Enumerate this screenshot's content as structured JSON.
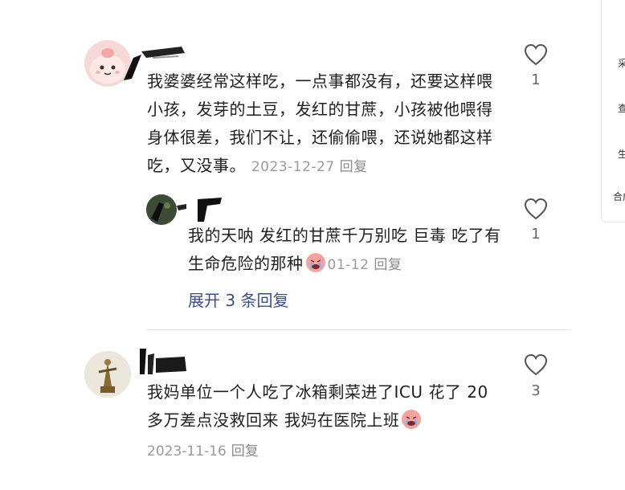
{
  "comments": [
    {
      "text": "我婆婆经常这样吃，一点事都没有，还要这样喂小孩，发芽的土豆，发红的甘蔗，小孩被他喂得身体很差，我们不让，还偷偷喂，还说她都这样吃，又没事。",
      "date": "2023-12-27",
      "reply_label": "回复",
      "likes": "1",
      "reply": {
        "text": "我的天呐 发红的甘蔗千万别吃 巨毒 吃了有生命危险的那种",
        "date": "01-12",
        "reply_label": "回复",
        "likes": "1"
      },
      "expand_label": "展开 3 条回复"
    },
    {
      "text": "我妈单位一个人吃了冰箱剩菜进了ICU 花了 20 多万差点没救回来 我妈在医院上班",
      "date": "2023-11-16",
      "reply_label": "回复",
      "likes": "3"
    }
  ],
  "sidebar": {
    "items": [
      "采",
      "查",
      "生",
      "合成"
    ]
  },
  "colors": {
    "text": "#1f1f1f",
    "meta": "#9a9a9a",
    "link": "#3b4f86",
    "heart_stroke": "#555555"
  }
}
